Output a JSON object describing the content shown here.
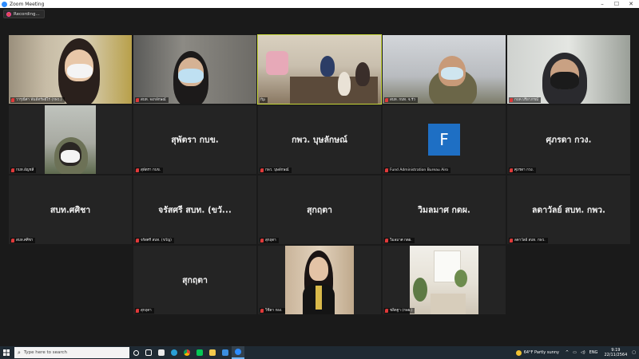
{
  "window": {
    "title": "Zoom Meeting",
    "minimize": "–",
    "maximize": "☐",
    "close": "✕"
  },
  "recording": {
    "label": "Recording..."
  },
  "participants": [
    {
      "name": "วารุณีศา พันธ์ทรัพย์ไร่ (กพว.)",
      "display": "",
      "kind": "video",
      "active": false
    },
    {
      "name": "สบท. จงกลักษณ์",
      "display": "",
      "kind": "video",
      "active": false
    },
    {
      "name": "ftp",
      "display": "",
      "kind": "video",
      "active": true
    },
    {
      "name": "สบท. กบท. จ.รั่ว",
      "display": "",
      "kind": "video",
      "active": false
    },
    {
      "name": "กบท.ปรียาภรณ์",
      "display": "",
      "kind": "video",
      "active": false
    },
    {
      "name": "กบท.อัญชลี",
      "display": "",
      "kind": "video",
      "active": false
    },
    {
      "name": "สุพัตรา กบข.",
      "display": "สุพัตรา กบข.",
      "kind": "name",
      "active": false
    },
    {
      "name": "กพว. บุษลักษณ์",
      "display": "กพว. บุษลักษณ์",
      "kind": "name",
      "active": false
    },
    {
      "name": "Fund Administration Bureau Airo",
      "display": "F",
      "kind": "avatar",
      "active": false
    },
    {
      "name": "ศุภรดา กวง.",
      "display": "ศุภรดา กวง.",
      "kind": "name",
      "active": false
    },
    {
      "name": "สบท.ศศิชา",
      "display": "สบท.ศศิชา",
      "kind": "name",
      "active": false
    },
    {
      "name": "จรัสศรี สบท. (ขวัญ)",
      "display": "จรัสศรี สบท. (ขวั...",
      "kind": "name",
      "active": false
    },
    {
      "name": "สุกฤตา",
      "display": "สุกฤตา",
      "kind": "name",
      "active": false
    },
    {
      "name": "วิมลมาศ กดผ.",
      "display": "วิมลมาศ กดผ.",
      "kind": "name",
      "active": false
    },
    {
      "name": "ลดาวัลย์ สบท. กพว.",
      "display": "ลดาวัลย์ สบท. กพว.",
      "kind": "name",
      "active": false
    },
    {
      "name": "สุกฤตา",
      "display": "สุกฤตา",
      "kind": "name",
      "active": false
    },
    {
      "name": "วิชิดา กอง.",
      "display": "",
      "kind": "video",
      "active": false
    },
    {
      "name": "ชลิตฐา (กพผ.)",
      "display": "",
      "kind": "video",
      "active": false
    }
  ],
  "taskbar": {
    "start_icon": "windows-logo-icon",
    "search_placeholder": "Type here to search",
    "weather": "64°F  Partly sunny",
    "time": "9:19",
    "date": "22/11/2564",
    "tray_lang": "ENG"
  }
}
